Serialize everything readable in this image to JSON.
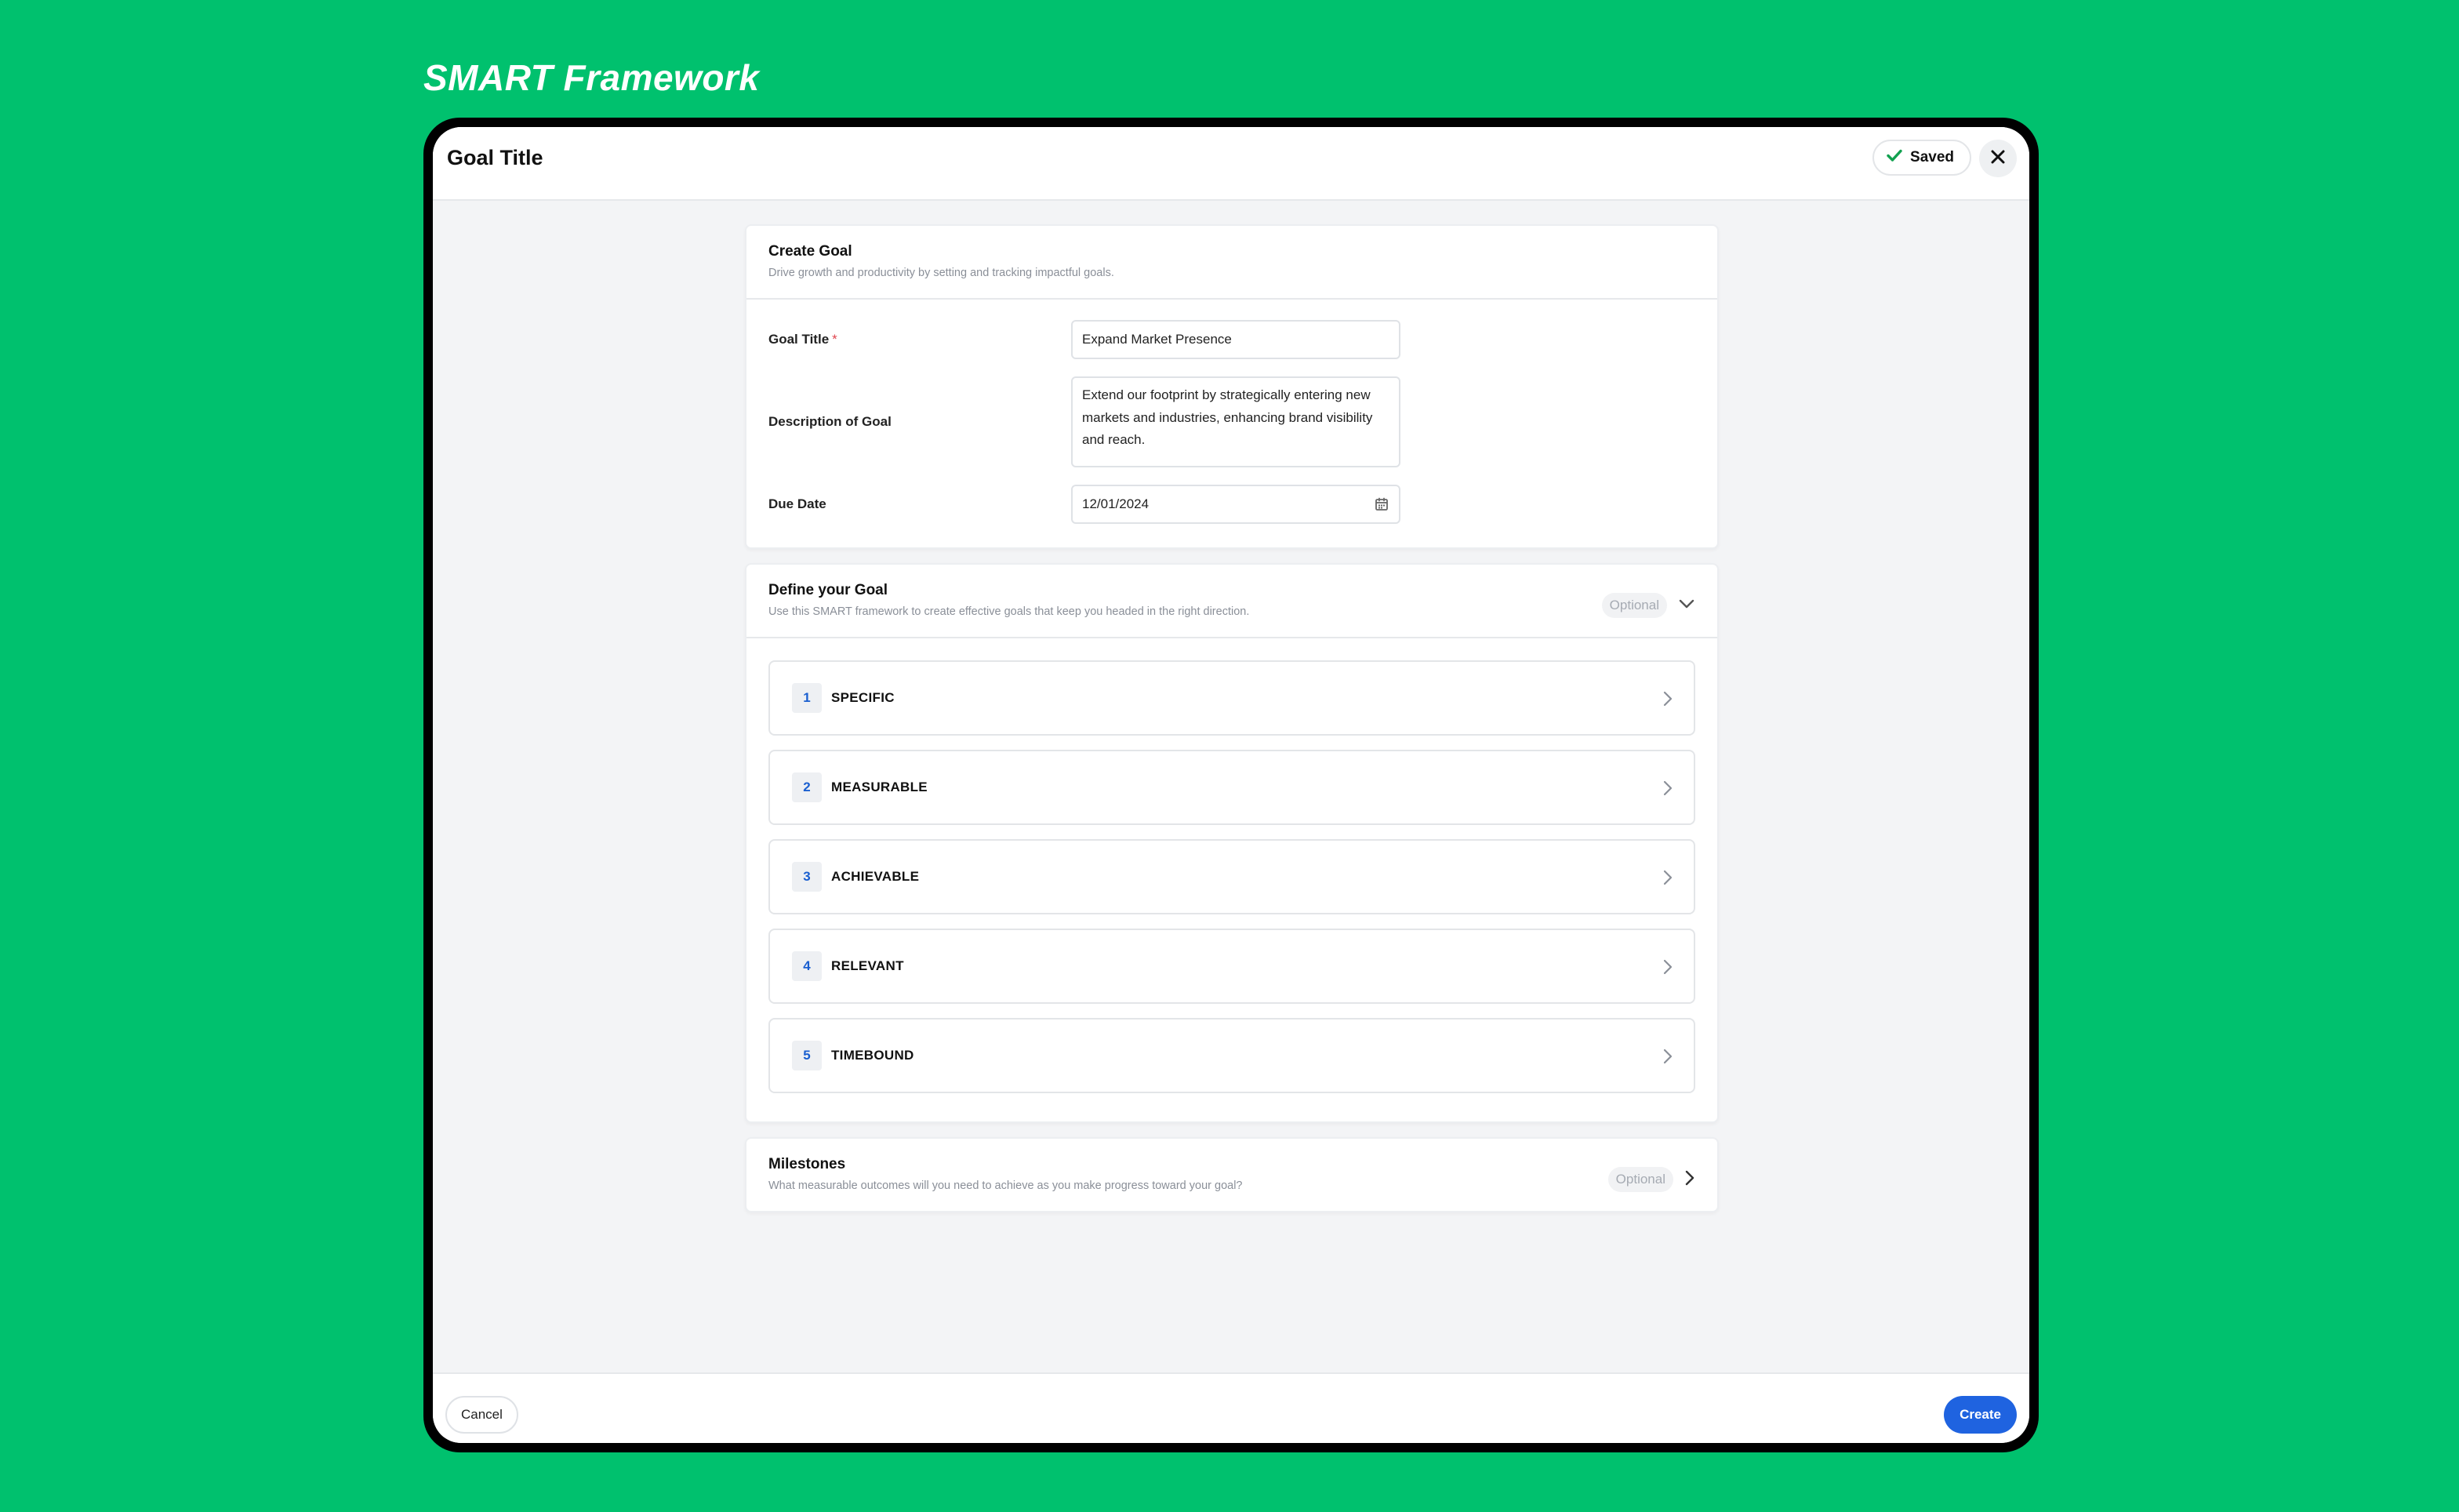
{
  "page_heading": "SMART Framework",
  "topbar": {
    "title": "Goal Title",
    "saved_label": "Saved"
  },
  "create_goal": {
    "title": "Create Goal",
    "subtitle": "Drive growth and productivity by setting and tracking impactful goals.",
    "fields": {
      "goal_title_label": "Goal Title",
      "required_marker": "*",
      "goal_title_value": "Expand Market Presence",
      "description_label": "Description of Goal",
      "description_value": "Extend our footprint by strategically entering new markets and industries, enhancing brand visibility and reach.",
      "due_date_label": "Due Date",
      "due_date_value": "12/01/2024"
    }
  },
  "define_goal": {
    "title": "Define your Goal",
    "subtitle": "Use this SMART framework to create effective goals that keep you headed in the right direction.",
    "optional_label": "Optional",
    "items": [
      {
        "number": "1",
        "label": "SPECIFIC"
      },
      {
        "number": "2",
        "label": "MEASURABLE"
      },
      {
        "number": "3",
        "label": "ACHIEVABLE"
      },
      {
        "number": "4",
        "label": "RELEVANT"
      },
      {
        "number": "5",
        "label": "TIMEBOUND"
      }
    ]
  },
  "milestones": {
    "title": "Milestones",
    "subtitle": "What measurable outcomes will you need to achieve as you make progress toward your goal?",
    "optional_label": "Optional"
  },
  "footer": {
    "cancel_label": "Cancel",
    "create_label": "Create"
  },
  "colors": {
    "background": "#00c16e",
    "accent": "#1f63e0",
    "saved_check": "#12a150"
  }
}
